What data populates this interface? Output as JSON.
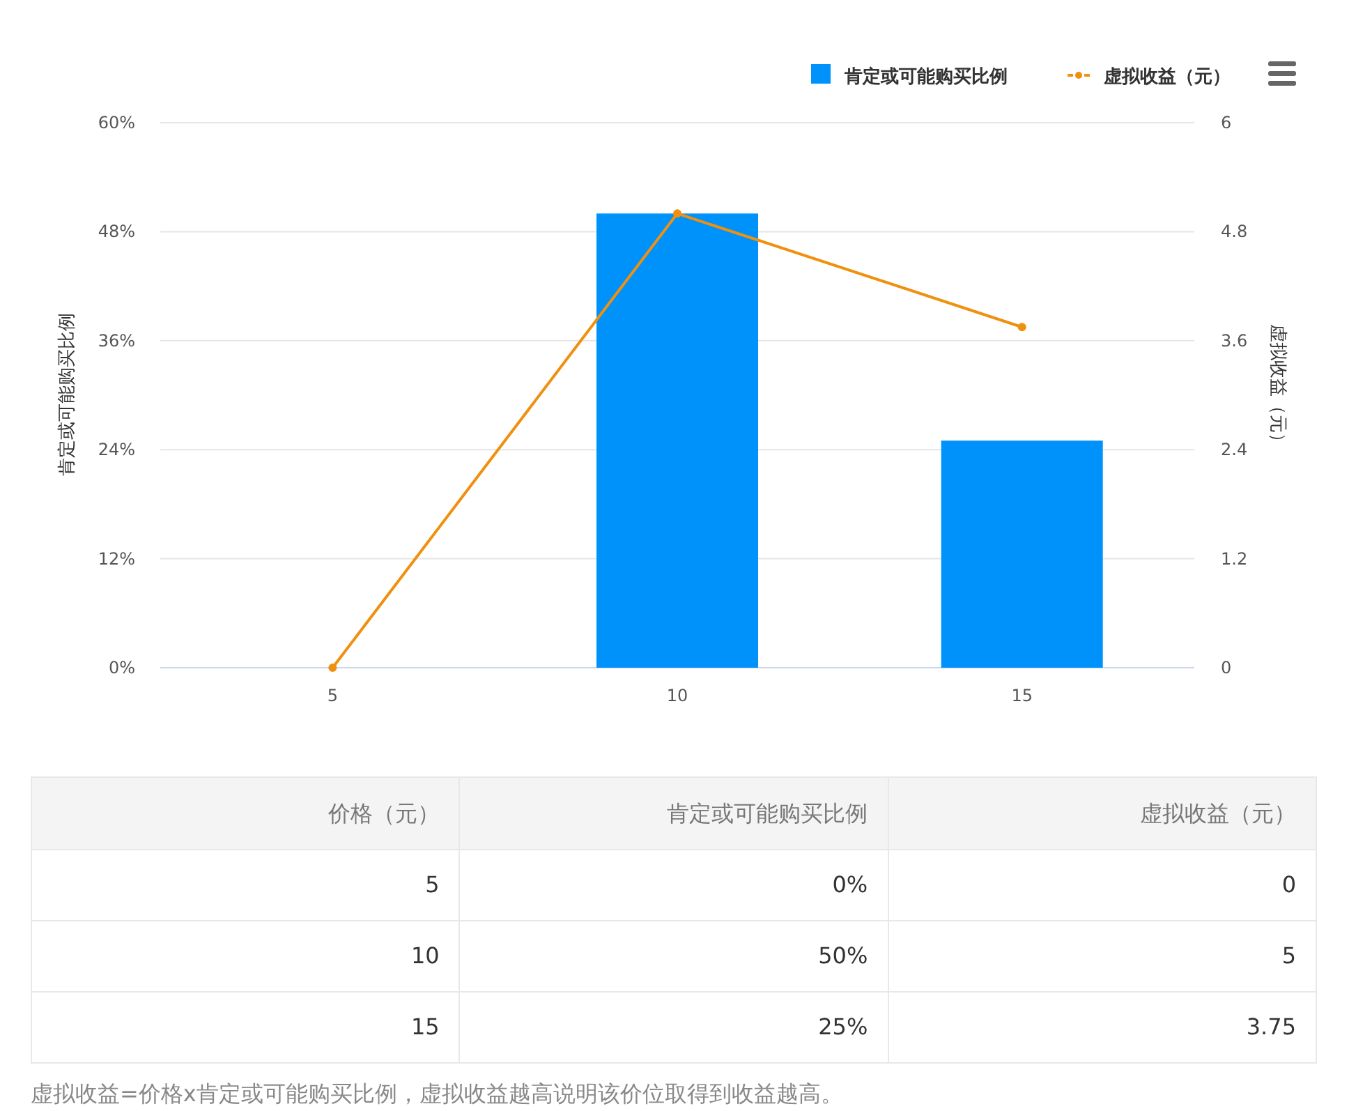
{
  "chart": {
    "chart_data": {
      "type": "bar",
      "categories": [
        "5",
        "10",
        "15"
      ],
      "series": [
        {
          "name": "肯定或可能购买比例",
          "color": "#0092fb",
          "values": [
            0,
            50,
            25
          ]
        },
        {
          "name": "虚拟收益（元）",
          "type": "line",
          "axis": "y2",
          "marker": "circle",
          "color": "#f0900f",
          "values": [
            0,
            5,
            3.75
          ]
        }
      ],
      "grid": true,
      "legend": "top-right",
      "ylabel": "肯定或可能购买比例",
      "ylim": [
        0,
        60
      ],
      "yticks": [
        {
          "value": 0,
          "label": "0%"
        },
        {
          "value": 12,
          "label": "12%"
        },
        {
          "value": 24,
          "label": "24%"
        },
        {
          "value": 36,
          "label": "36%"
        },
        {
          "value": 48,
          "label": "48%"
        },
        {
          "value": 60,
          "label": "60%"
        }
      ],
      "y2label": "虚拟收益（元）",
      "y2lim": [
        0,
        6
      ],
      "y2ticks": [
        {
          "value": 0,
          "label": "0"
        },
        {
          "value": 1.2,
          "label": "1.2"
        },
        {
          "value": 2.4,
          "label": "2.4"
        },
        {
          "value": 3.6,
          "label": "3.6"
        },
        {
          "value": 4.8,
          "label": "4.8"
        },
        {
          "value": 6,
          "label": "6"
        }
      ]
    }
  },
  "table": {
    "columns": [
      "价格（元）",
      "肯定或可能购买比例",
      "虚拟收益（元）"
    ],
    "rows": [
      [
        "5",
        "0%",
        "0"
      ],
      [
        "10",
        "50%",
        "5"
      ],
      [
        "15",
        "25%",
        "3.75"
      ]
    ]
  },
  "note": "虚拟收益=价格x肯定或可能购买比例，虚拟收益越高说明该价位取得到收益越高。"
}
